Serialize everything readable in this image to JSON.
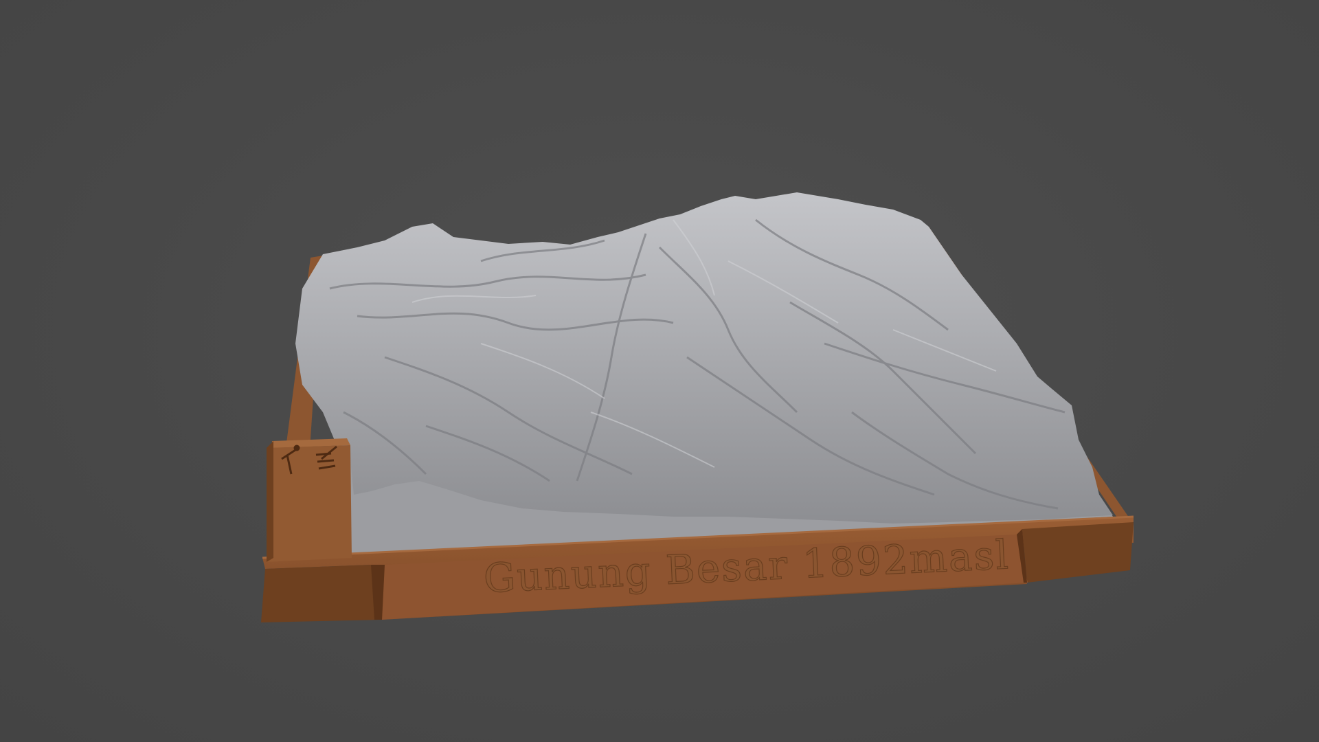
{
  "scene": {
    "subject": "3D printed terrain model on wooden-style base",
    "background_color": "#4a4a4a",
    "terrain_color": "#a9aaae",
    "base_color": "#8b5530",
    "base_shadow_color": "#6b3f1f",
    "base_label": "Gunung Besar 1892masl",
    "icon": "hiker-icon"
  }
}
